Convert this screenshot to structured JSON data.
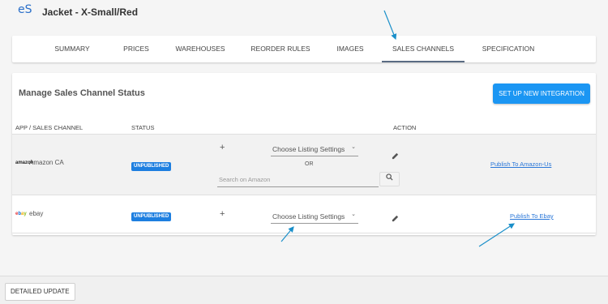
{
  "app": {
    "logo": "eS",
    "title": "Jacket - X-Small/Red"
  },
  "tabs": [
    {
      "label": "SUMMARY"
    },
    {
      "label": "PRICES"
    },
    {
      "label": "WAREHOUSES"
    },
    {
      "label": "REORDER RULES"
    },
    {
      "label": "IMAGES"
    },
    {
      "label": "SALES CHANNELS",
      "active": true
    },
    {
      "label": "SPECIFICATION"
    }
  ],
  "panel": {
    "title": "Manage Sales Channel Status",
    "setup_button": "SET UP NEW INTEGRATION",
    "columns": {
      "channel": "APP / SALES CHANNEL",
      "status": "STATUS",
      "action": "ACTION"
    },
    "rows": [
      {
        "logo_text": "amazon",
        "name": "Amazon CA",
        "status": "UNPUBLISHED",
        "plus": "+",
        "listing_select": "Choose Listing Settings",
        "or_label": "OR",
        "search_placeholder": "Search on Amazon",
        "publish_link": "Publish To Amazon-Us"
      },
      {
        "logo_text": "ebay",
        "name": "ebay",
        "status": "UNPUBLISHED",
        "plus": "+",
        "listing_select": "Choose Listing Settings",
        "publish_link": "Publish To Ebay"
      }
    ]
  },
  "footer": {
    "detailed_update": "DETAILED UPDATE"
  },
  "colors": {
    "primary": "#1b96f3",
    "badge": "#1e7fe0",
    "link": "#2a77d8",
    "annotation": "#1a8fc9"
  },
  "icons": {
    "chevron": "chevron-down-icon",
    "edit": "pencil-icon",
    "search": "search-icon"
  }
}
